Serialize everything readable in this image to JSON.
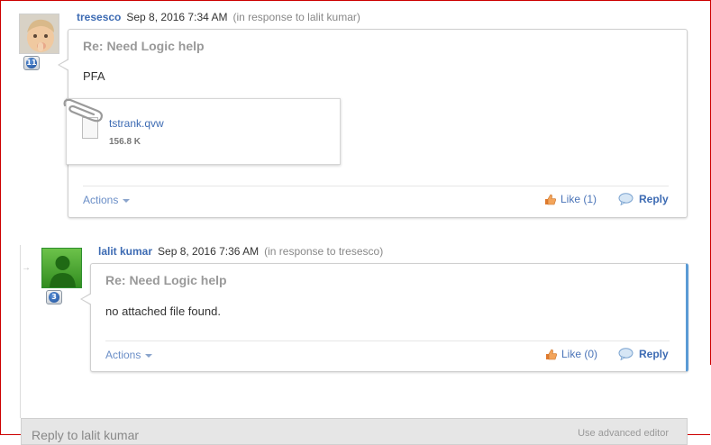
{
  "posts": [
    {
      "author": "tresesco",
      "date": "Sep 8, 2016 7:34 AM",
      "in_response": "(in response to lalit kumar)",
      "badge": "11",
      "subject": "Re: Need Logic help",
      "body": "PFA",
      "attachment": {
        "name": "tstrank.qvw",
        "size": "156.8 K"
      },
      "actions_label": "Actions",
      "like_label": "Like (1)",
      "reply_label": "Reply"
    },
    {
      "author": "lalit kumar",
      "date": "Sep 8, 2016 7:36 AM",
      "in_response": "(in response to tresesco)",
      "badge": "3",
      "subject": "Re: Need Logic help",
      "body": "no attached file found.",
      "actions_label": "Actions",
      "like_label": "Like (0)",
      "reply_label": "Reply"
    }
  ],
  "reply_bar": {
    "label": "Reply to lalit kumar",
    "right_text": "Use advanced editor"
  },
  "colors": {
    "link": "#3d6bb3",
    "highlight": "#5b9bd5",
    "frame": "#cc0000"
  },
  "icons": [
    "paperclip-icon",
    "file-icon",
    "thumbs-up-icon",
    "speech-bubble-icon",
    "caret-down-icon",
    "avatar-icon",
    "points-badge-icon"
  ]
}
